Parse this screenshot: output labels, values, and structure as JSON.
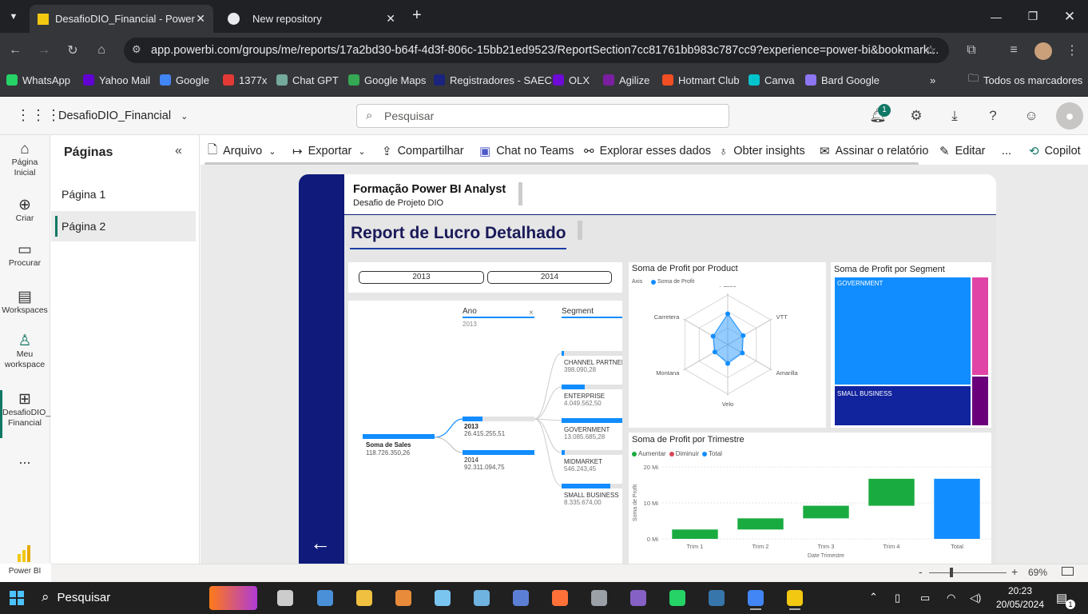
{
  "browser": {
    "tabs": [
      {
        "title": "DesafioDIO_Financial - Power BI",
        "active": true
      },
      {
        "title": "New repository",
        "active": false
      }
    ],
    "new_tab": "+",
    "url": "app.powerbi.com/groups/me/reports/17a2bd30-b64f-4d3f-806c-15bb21ed9523/ReportSection7cc81761bb983c787cc9?experience=power-bi&bookmark...",
    "bookmarks": [
      {
        "label": "WhatsApp",
        "color": "#25d366"
      },
      {
        "label": "Yahoo Mail",
        "color": "#6001d2"
      },
      {
        "label": "Google",
        "color": "#4285f4"
      },
      {
        "label": "1377x",
        "color": "#e53935"
      },
      {
        "label": "Chat GPT",
        "color": "#74aa9c"
      },
      {
        "label": "Google Maps",
        "color": "#34a853"
      },
      {
        "label": "Registradores - SAEC",
        "color": "#1a237e"
      },
      {
        "label": "OLX",
        "color": "#6e0ad6"
      },
      {
        "label": "Agilize",
        "color": "#7b1fa2"
      },
      {
        "label": "Hotmart Club",
        "color": "#f04e23"
      },
      {
        "label": "Canva",
        "color": "#00c4cc"
      },
      {
        "label": "Bard Google",
        "color": "#8e75f2"
      }
    ],
    "bookmarks_overflow": "»",
    "all_bookmarks": "Todos os marcadores"
  },
  "pbi": {
    "workspace_title": "DesafioDIO_Financial",
    "search_placeholder": "Pesquisar",
    "notification_count": "1",
    "left_nav": [
      {
        "label": "Página Inicial",
        "icon": "home-icon"
      },
      {
        "label": "Criar",
        "icon": "create-icon"
      },
      {
        "label": "Procurar",
        "icon": "browse-icon"
      },
      {
        "label": "Workspaces",
        "icon": "workspaces-icon"
      },
      {
        "label": "Meu workspace",
        "icon": "my-workspace-icon"
      },
      {
        "label": "DesafioDIO_ Financial",
        "icon": "report-icon"
      },
      {
        "label": "...",
        "icon": "more-icon"
      }
    ],
    "brand": "Power BI",
    "pages_title": "Páginas",
    "pages": [
      {
        "label": "Página 1",
        "active": false
      },
      {
        "label": "Página 2",
        "active": true
      }
    ],
    "ribbon": [
      "Arquivo",
      "Exportar",
      "Compartilhar",
      "Chat no Teams",
      "Explorar esses dados",
      "Obter insights",
      "Assinar o relatório",
      "Editar",
      "...",
      "Copilot"
    ],
    "zoom": "69%",
    "zoom_minus": "-",
    "zoom_plus": "+"
  },
  "report": {
    "header_title": "Formação Power BI Analyst",
    "header_subtitle": "Desafio de Projeto DIO",
    "page_title": "Report de Lucro Detalhado",
    "accent": "#0f1a7a",
    "slicer_years": [
      "2013",
      "2014"
    ],
    "decomp": {
      "col_ano": "Ano",
      "col_ano_sel": "2013",
      "col_segment": "Segment",
      "close": "×",
      "root_label": "Soma de Sales",
      "root_value": "118.726.350,26",
      "years": [
        {
          "label": "2013",
          "value": "26.415.255,51",
          "fill": 0.28
        },
        {
          "label": "2014",
          "value": "92.311.094,75",
          "fill": 1.0
        }
      ],
      "segments": [
        {
          "label": "CHANNEL PARTNERS",
          "value": "398.090,28",
          "fill": 0.04
        },
        {
          "label": "ENTERPRISE",
          "value": "4.049.562,50",
          "fill": 0.38
        },
        {
          "label": "GOVERNMENT",
          "value": "13.085.685,28",
          "fill": 1.0
        },
        {
          "label": "MIDMARKET",
          "value": "546.243,45",
          "fill": 0.05
        },
        {
          "label": "SMALL BUSINESS",
          "value": "8.335.674,00",
          "fill": 0.8
        }
      ]
    },
    "radar": {
      "title": "Soma de Profit por Product",
      "legend_axis": "Axis",
      "legend_series": "Soma de Profit",
      "axes": [
        "Paseo",
        "VTT",
        "Amarilla",
        "Velo",
        "Montana",
        "Carretera"
      ],
      "values": [
        0.62,
        0.36,
        0.34,
        0.38,
        0.3,
        0.34
      ]
    },
    "treemap": {
      "title": "Soma de Profit por Segment",
      "labels": [
        "GOVERNMENT",
        "SMALL BUSINESS"
      ],
      "colors": [
        "#118dff",
        "#12239e",
        "#e044a7",
        "#6b007b"
      ]
    },
    "waterfall": {
      "title": "Soma de Profit por Trimestre",
      "legend": [
        {
          "label": "Aumentar",
          "color": "#1aab40"
        },
        {
          "label": "Diminuir",
          "color": "#d64554"
        },
        {
          "label": "Total",
          "color": "#118dff"
        }
      ],
      "ylabel": "Soma de Profit",
      "xlabel": "Date Trimestre",
      "yticks": [
        "20 Mi",
        "10 Mi",
        "0 Mi"
      ],
      "categories": [
        "Trim 1",
        "Trim 2",
        "Trim 3",
        "Trim 4",
        "Total"
      ]
    }
  },
  "chart_data": {
    "type": "bar",
    "title": "Soma de Profit por Trimestre",
    "xlabel": "Date Trimestre",
    "ylabel": "Soma de Profit",
    "ylim": [
      0,
      20
    ],
    "categories": [
      "Trim 1",
      "Trim 2",
      "Trim 3",
      "Trim 4",
      "Total"
    ],
    "series": [
      {
        "name": "Aumentar",
        "start": [
          0,
          2.6,
          5.7,
          9.2,
          null
        ],
        "end": [
          2.6,
          5.7,
          9.2,
          16.7,
          null
        ]
      },
      {
        "name": "Total",
        "start": [
          null,
          null,
          null,
          null,
          0
        ],
        "end": [
          null,
          null,
          null,
          null,
          16.7
        ]
      }
    ]
  },
  "taskbar": {
    "search": "Pesquisar",
    "time": "20:23",
    "date": "20/05/2024",
    "notif": "1"
  }
}
